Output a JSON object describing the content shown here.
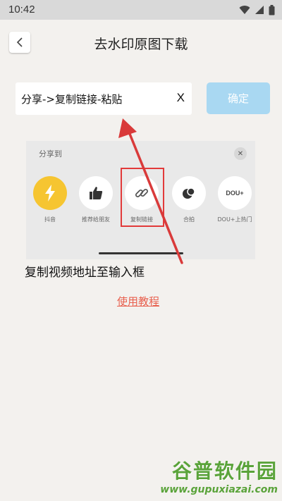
{
  "status_bar": {
    "time": "10:42"
  },
  "header": {
    "title": "去水印原图下载"
  },
  "input": {
    "value": "分享->复制链接-粘贴",
    "clear_label": "X"
  },
  "confirm": {
    "label": "确定"
  },
  "guide": {
    "header": "分享到",
    "items": [
      {
        "label": "抖音",
        "icon": "lightning-icon",
        "color": "#f6c531"
      },
      {
        "label": "推荐给朋友",
        "icon": "thumbs-up-icon",
        "color": "#ffffff"
      },
      {
        "label": "复制链接",
        "icon": "link-icon",
        "color": "#ffffff"
      },
      {
        "label": "合拍",
        "icon": "duet-icon",
        "color": "#ffffff"
      },
      {
        "label": "DOU+上热门",
        "icon": "dou-icon",
        "color": "#ffffff",
        "badge": "DOU+"
      }
    ],
    "highlight_color": "#e23a3a"
  },
  "instruction": "复制视频地址至输入框",
  "tutorial_link": "使用教程",
  "watermark": {
    "title": "谷普软件园",
    "url": "www.gupuxiazai.com"
  },
  "colors": {
    "accent_button": "#a9d8f2",
    "link": "#e8604e",
    "arrow": "#d93a3a"
  }
}
